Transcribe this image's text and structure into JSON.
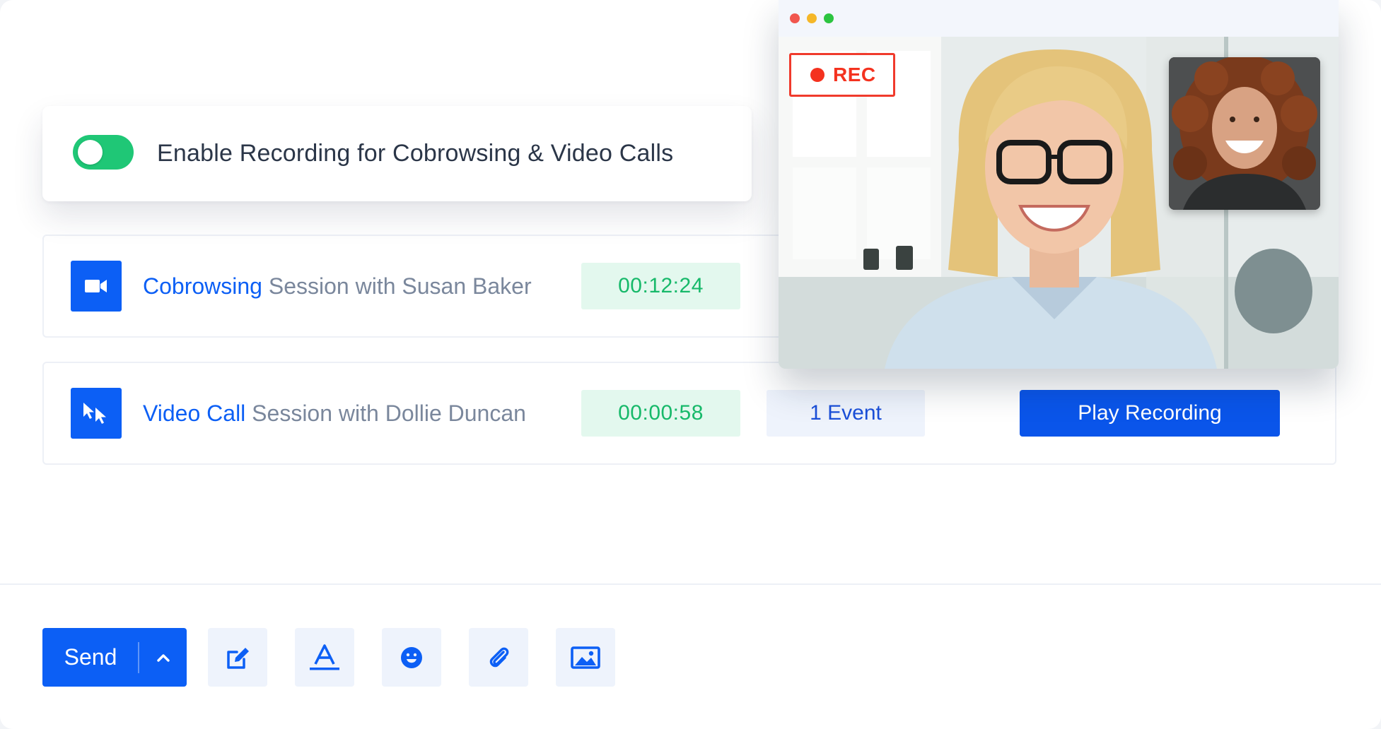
{
  "toggle_card": {
    "label": "Enable Recording for Cobrowsing & Video Calls",
    "enabled": true
  },
  "sessions": [
    {
      "icon": "video-camera-icon",
      "kind": "Cobrowsing",
      "rest": " Session with Susan Baker",
      "duration": "00:12:24"
    },
    {
      "icon": "cursor-icon",
      "kind": "Video Call",
      "rest": " Session with Dollie Duncan",
      "duration": "00:00:58",
      "events": "1 Event",
      "play_label": "Play Recording"
    }
  ],
  "video_window": {
    "rec_label": "REC"
  },
  "toolbar": {
    "send_label": "Send",
    "tools": [
      "edit-icon",
      "text-format-icon",
      "emoji-icon",
      "attachment-icon",
      "image-icon"
    ]
  },
  "colors": {
    "brand_blue": "#0c5ff5",
    "success_green": "#1fc776",
    "record_red": "#f4321f"
  }
}
